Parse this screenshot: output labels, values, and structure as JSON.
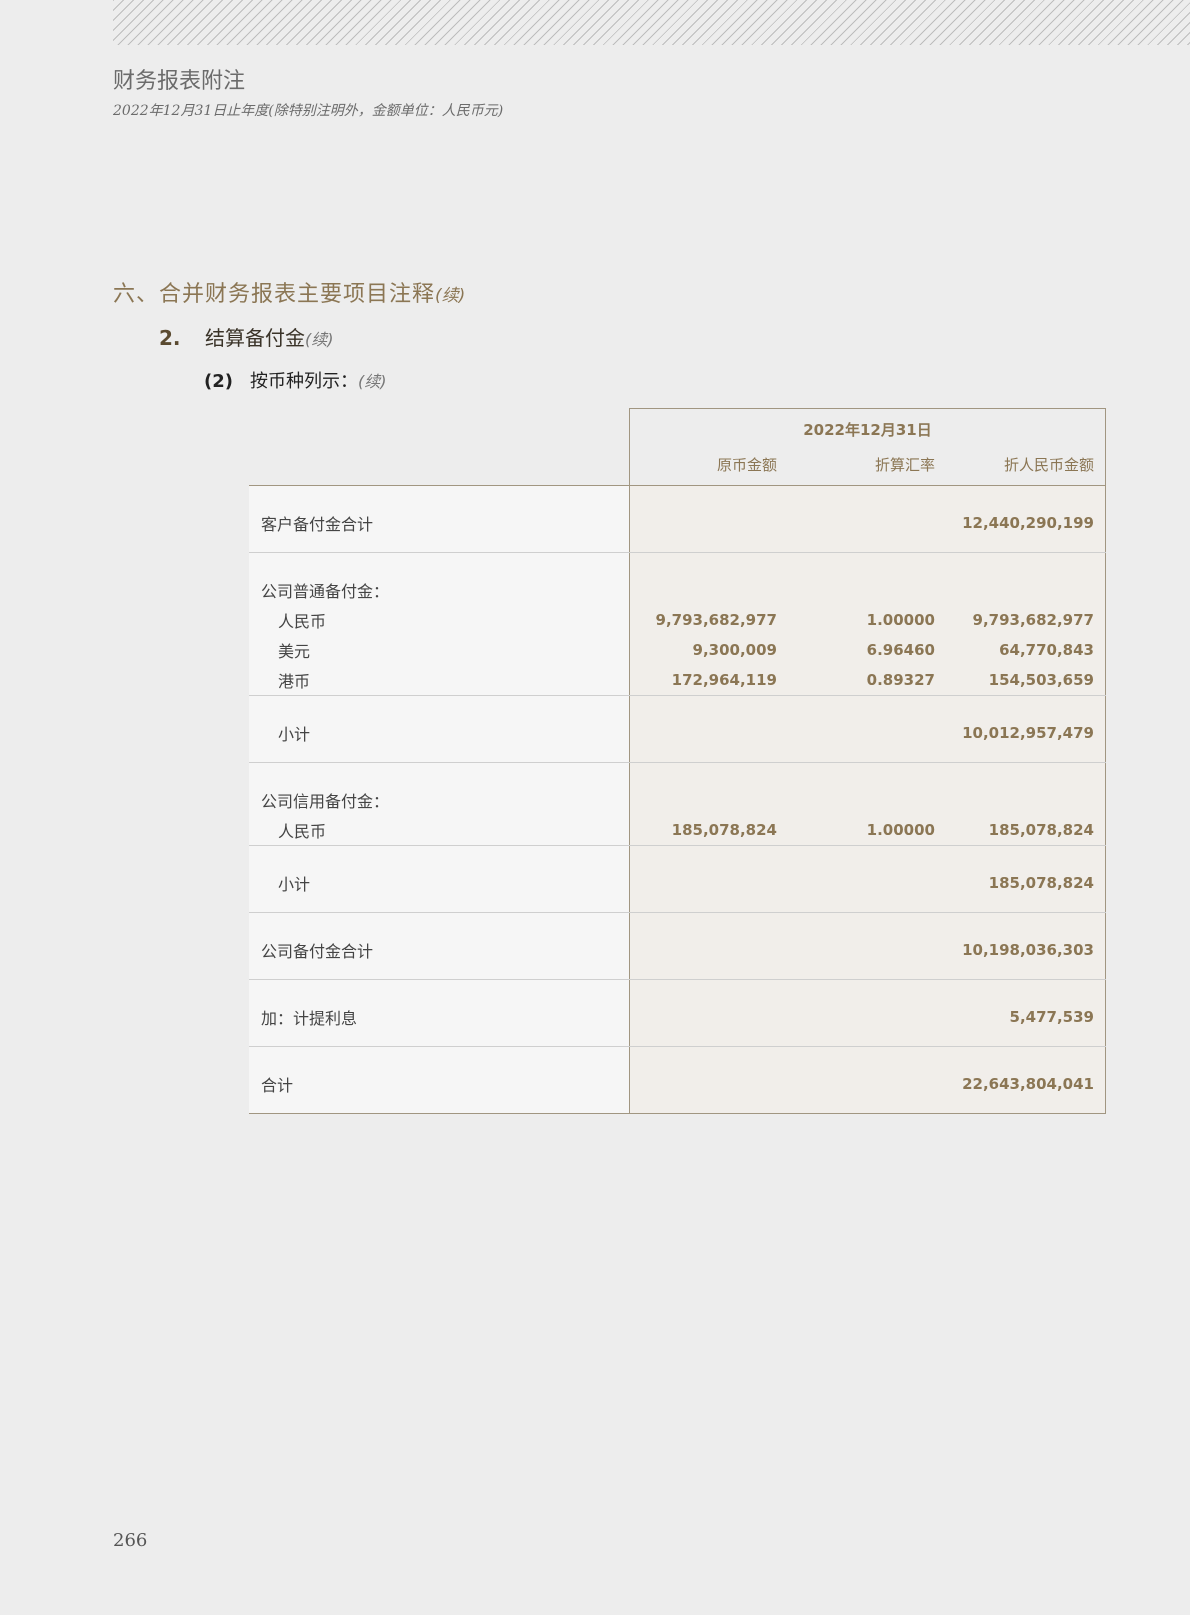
{
  "header": {
    "title": "财务报表附注",
    "subtitle": "2022年12月31日止年度(除特别注明外，金额单位：人民币元)"
  },
  "section": {
    "title": "六、合并财务报表主要项目注释",
    "cont": "(续)"
  },
  "subsection": {
    "num": "2.",
    "title": "结算备付金",
    "cont": "(续)"
  },
  "subsubsection": {
    "num": "(2)",
    "title": "按币种列示：",
    "cont": "(续)"
  },
  "table": {
    "date_header": "2022年12月31日",
    "col1_header": "原币金额",
    "col2_header": "折算汇率",
    "col3_header": "折人民币金额",
    "rows": {
      "cust_total": {
        "label": "客户备付金合计",
        "rmb": "12,440,290,199"
      },
      "gen_heading": "公司普通备付金：",
      "gen_cny": {
        "label": "人民币",
        "orig": "9,793,682,977",
        "rate": "1.00000",
        "rmb": "9,793,682,977"
      },
      "gen_usd": {
        "label": "美元",
        "orig": "9,300,009",
        "rate": "6.96460",
        "rmb": "64,770,843"
      },
      "gen_hkd": {
        "label": "港币",
        "orig": "172,964,119",
        "rate": "0.89327",
        "rmb": "154,503,659"
      },
      "gen_subtotal": {
        "label": "小计",
        "rmb": "10,012,957,479"
      },
      "cred_heading": "公司信用备付金：",
      "cred_cny": {
        "label": "人民币",
        "orig": "185,078,824",
        "rate": "1.00000",
        "rmb": "185,078,824"
      },
      "cred_subtotal": {
        "label": "小计",
        "rmb": "185,078,824"
      },
      "company_total": {
        "label": "公司备付金合计",
        "rmb": "10,198,036,303"
      },
      "interest": {
        "label": "加：计提利息",
        "rmb": "5,477,539"
      },
      "grand_total": {
        "label": "合计",
        "rmb": "22,643,804,041"
      }
    }
  },
  "page_number": "266"
}
